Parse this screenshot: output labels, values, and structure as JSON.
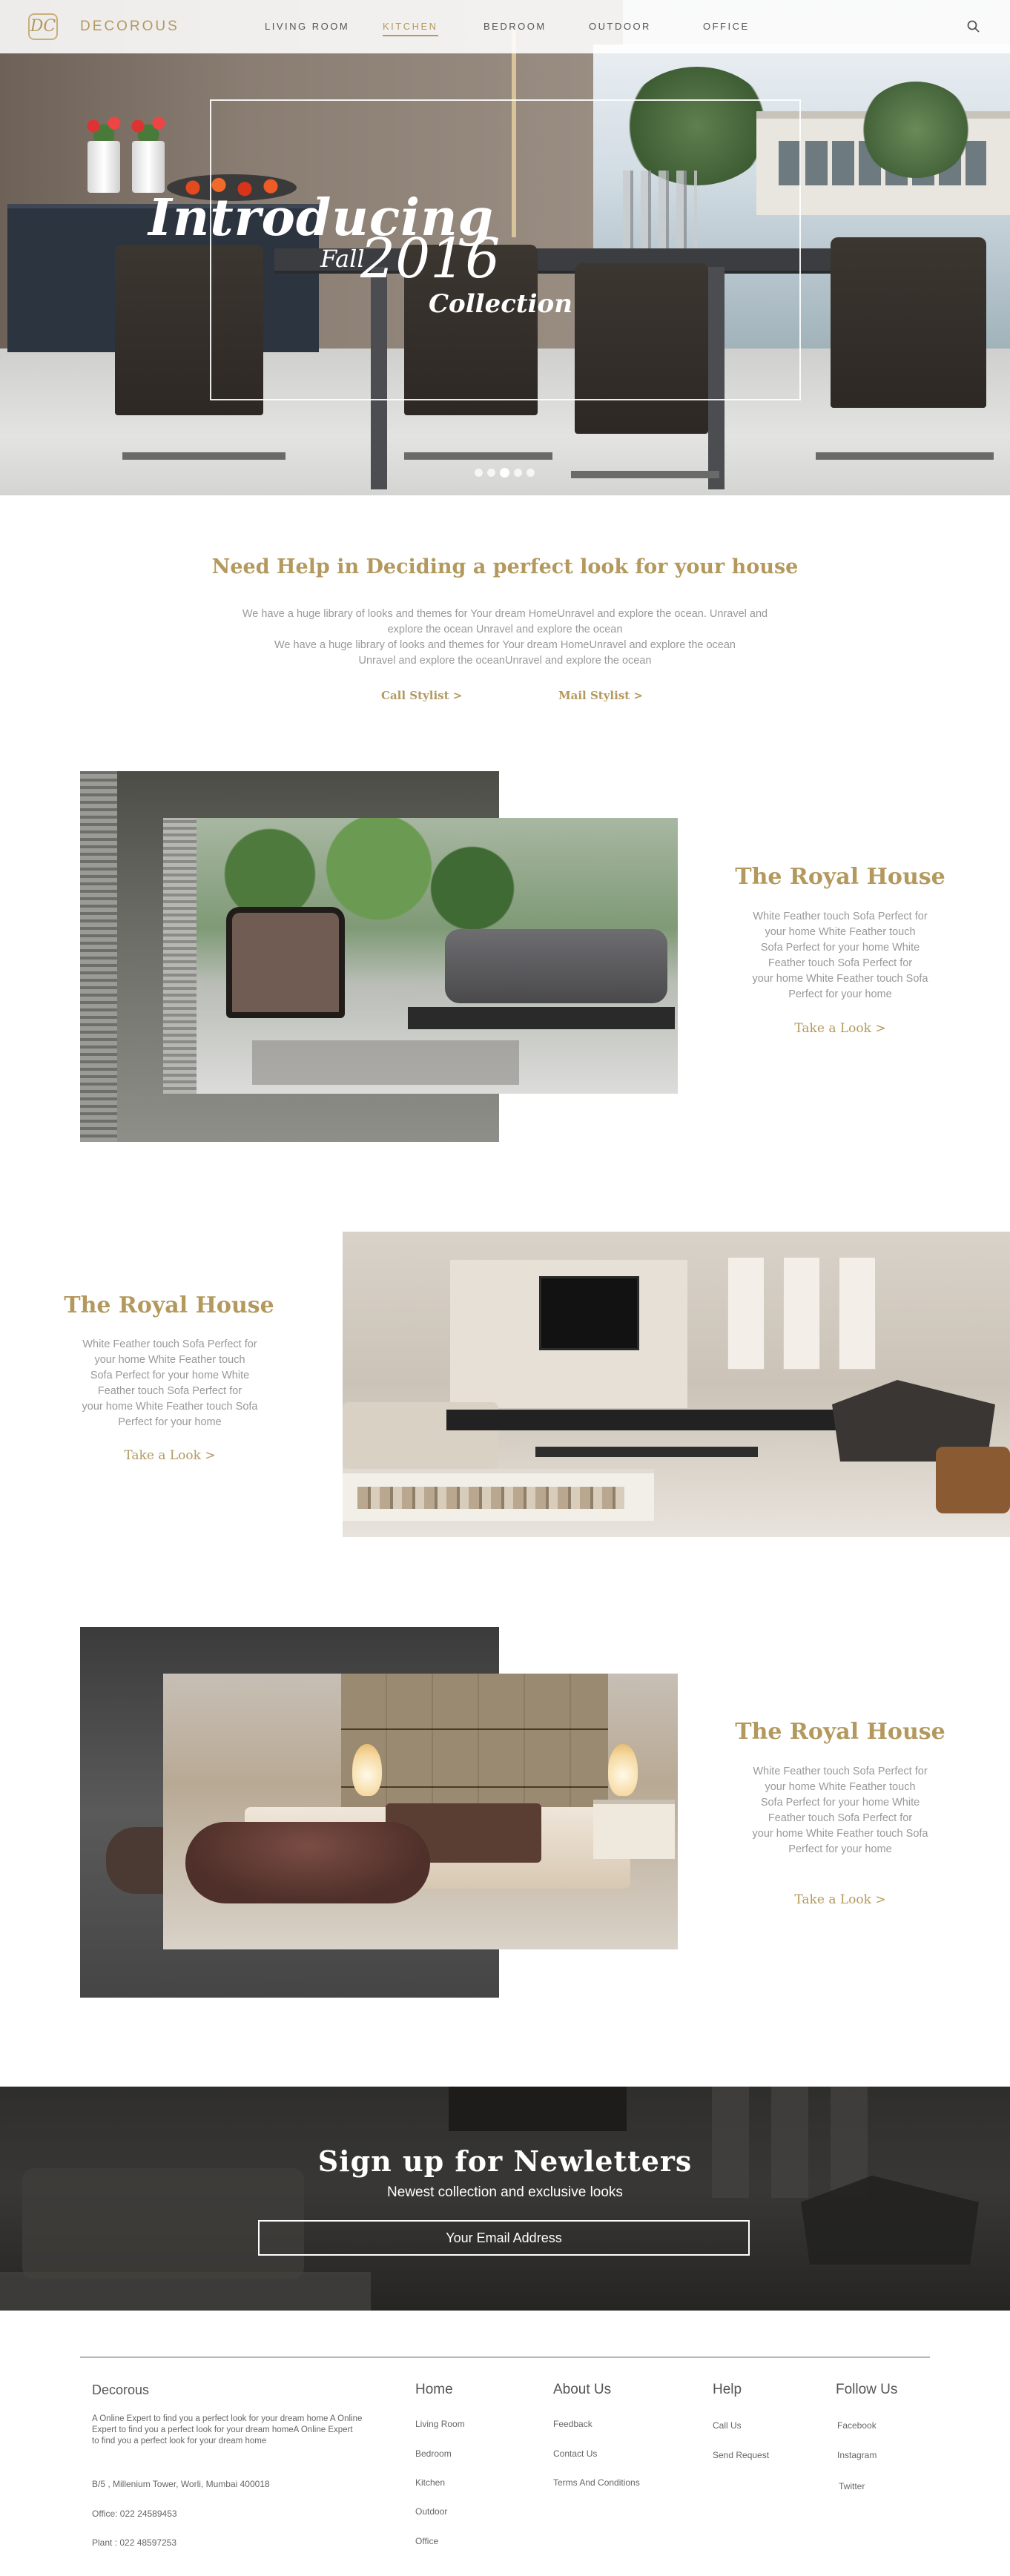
{
  "brand": {
    "logo_glyph": "DC",
    "name": "DECOROUS",
    "accent": "#b3995d"
  },
  "nav": {
    "items": [
      {
        "label": "LIVING ROOM",
        "active": false
      },
      {
        "label": "KITCHEN",
        "active": true
      },
      {
        "label": "BEDROOM",
        "active": false
      },
      {
        "label": "OUTDOOR",
        "active": false
      },
      {
        "label": "OFFICE",
        "active": false
      }
    ],
    "search_icon": "search-icon"
  },
  "hero": {
    "line1": "Introducing",
    "fall": "Fall",
    "year": "2016",
    "line3": "Collection",
    "slides": 5,
    "active_slide": 3
  },
  "help": {
    "title": "Need Help in Deciding a perfect look for your house",
    "text_line1": "We have a huge library of looks and themes for Your dream HomeUnravel and explore the ocean. Unravel and",
    "text_line2": "explore the ocean Unravel and explore the ocean",
    "text_line3": "We have a huge library of looks and themes for Your dream HomeUnravel and explore the ocean",
    "text_line4": "Unravel and explore the oceanUnravel and explore the ocean",
    "call_label": "Call Stylist >",
    "mail_label": "Mail Stylist >"
  },
  "features": [
    {
      "title": "The Royal House",
      "lines": [
        "White Feather touch Sofa Perfect for",
        "your home White Feather touch",
        "Sofa Perfect for your home White",
        "Feather touch Sofa Perfect for",
        "your home White Feather touch Sofa",
        "Perfect for your home"
      ],
      "link": "Take a Look >"
    },
    {
      "title": "The Royal House",
      "lines": [
        "White Feather touch Sofa Perfect for",
        "your home White Feather touch",
        "Sofa Perfect for your home White",
        "Feather touch Sofa Perfect for",
        "your home White Feather touch Sofa",
        "Perfect for your home"
      ],
      "link": "Take a Look >"
    },
    {
      "title": "The Royal House",
      "lines": [
        "White Feather touch Sofa Perfect for",
        "your home White Feather touch",
        "Sofa Perfect for your home White",
        "Feather touch Sofa Perfect for",
        "your home White Feather touch Sofa",
        "Perfect for your home"
      ],
      "link": "Take a Look >"
    }
  ],
  "newsletter": {
    "title": "Sign up for Newletters",
    "subtitle": "Newest collection and exclusive looks",
    "placeholder": "Your Email Address"
  },
  "footer": {
    "brand": "Decorous",
    "about_line1": "A Online Expert to find you a perfect look for your dream home A Online",
    "about_line2": "Expert to find you a perfect look for your dream homeA Online Expert",
    "about_line3": "to find you a perfect look for your dream home",
    "address": "B/5 , Millenium Tower, Worli, Mumbai 400018",
    "office": "Office: 022 24589453",
    "plant": "Plant : 022 48597253",
    "columns": [
      {
        "title": "Home",
        "links": [
          "Living Room",
          "Bedroom",
          "Kitchen",
          "Outdoor",
          "Office"
        ]
      },
      {
        "title": "About Us",
        "links": [
          "Feedback",
          "Contact Us",
          "Terms And Conditions"
        ]
      },
      {
        "title": "Help",
        "links": [
          "Call Us",
          "Send Request"
        ]
      },
      {
        "title": "Follow Us",
        "links": [
          "Facebook",
          "Instagram",
          "Twitter"
        ]
      }
    ]
  }
}
